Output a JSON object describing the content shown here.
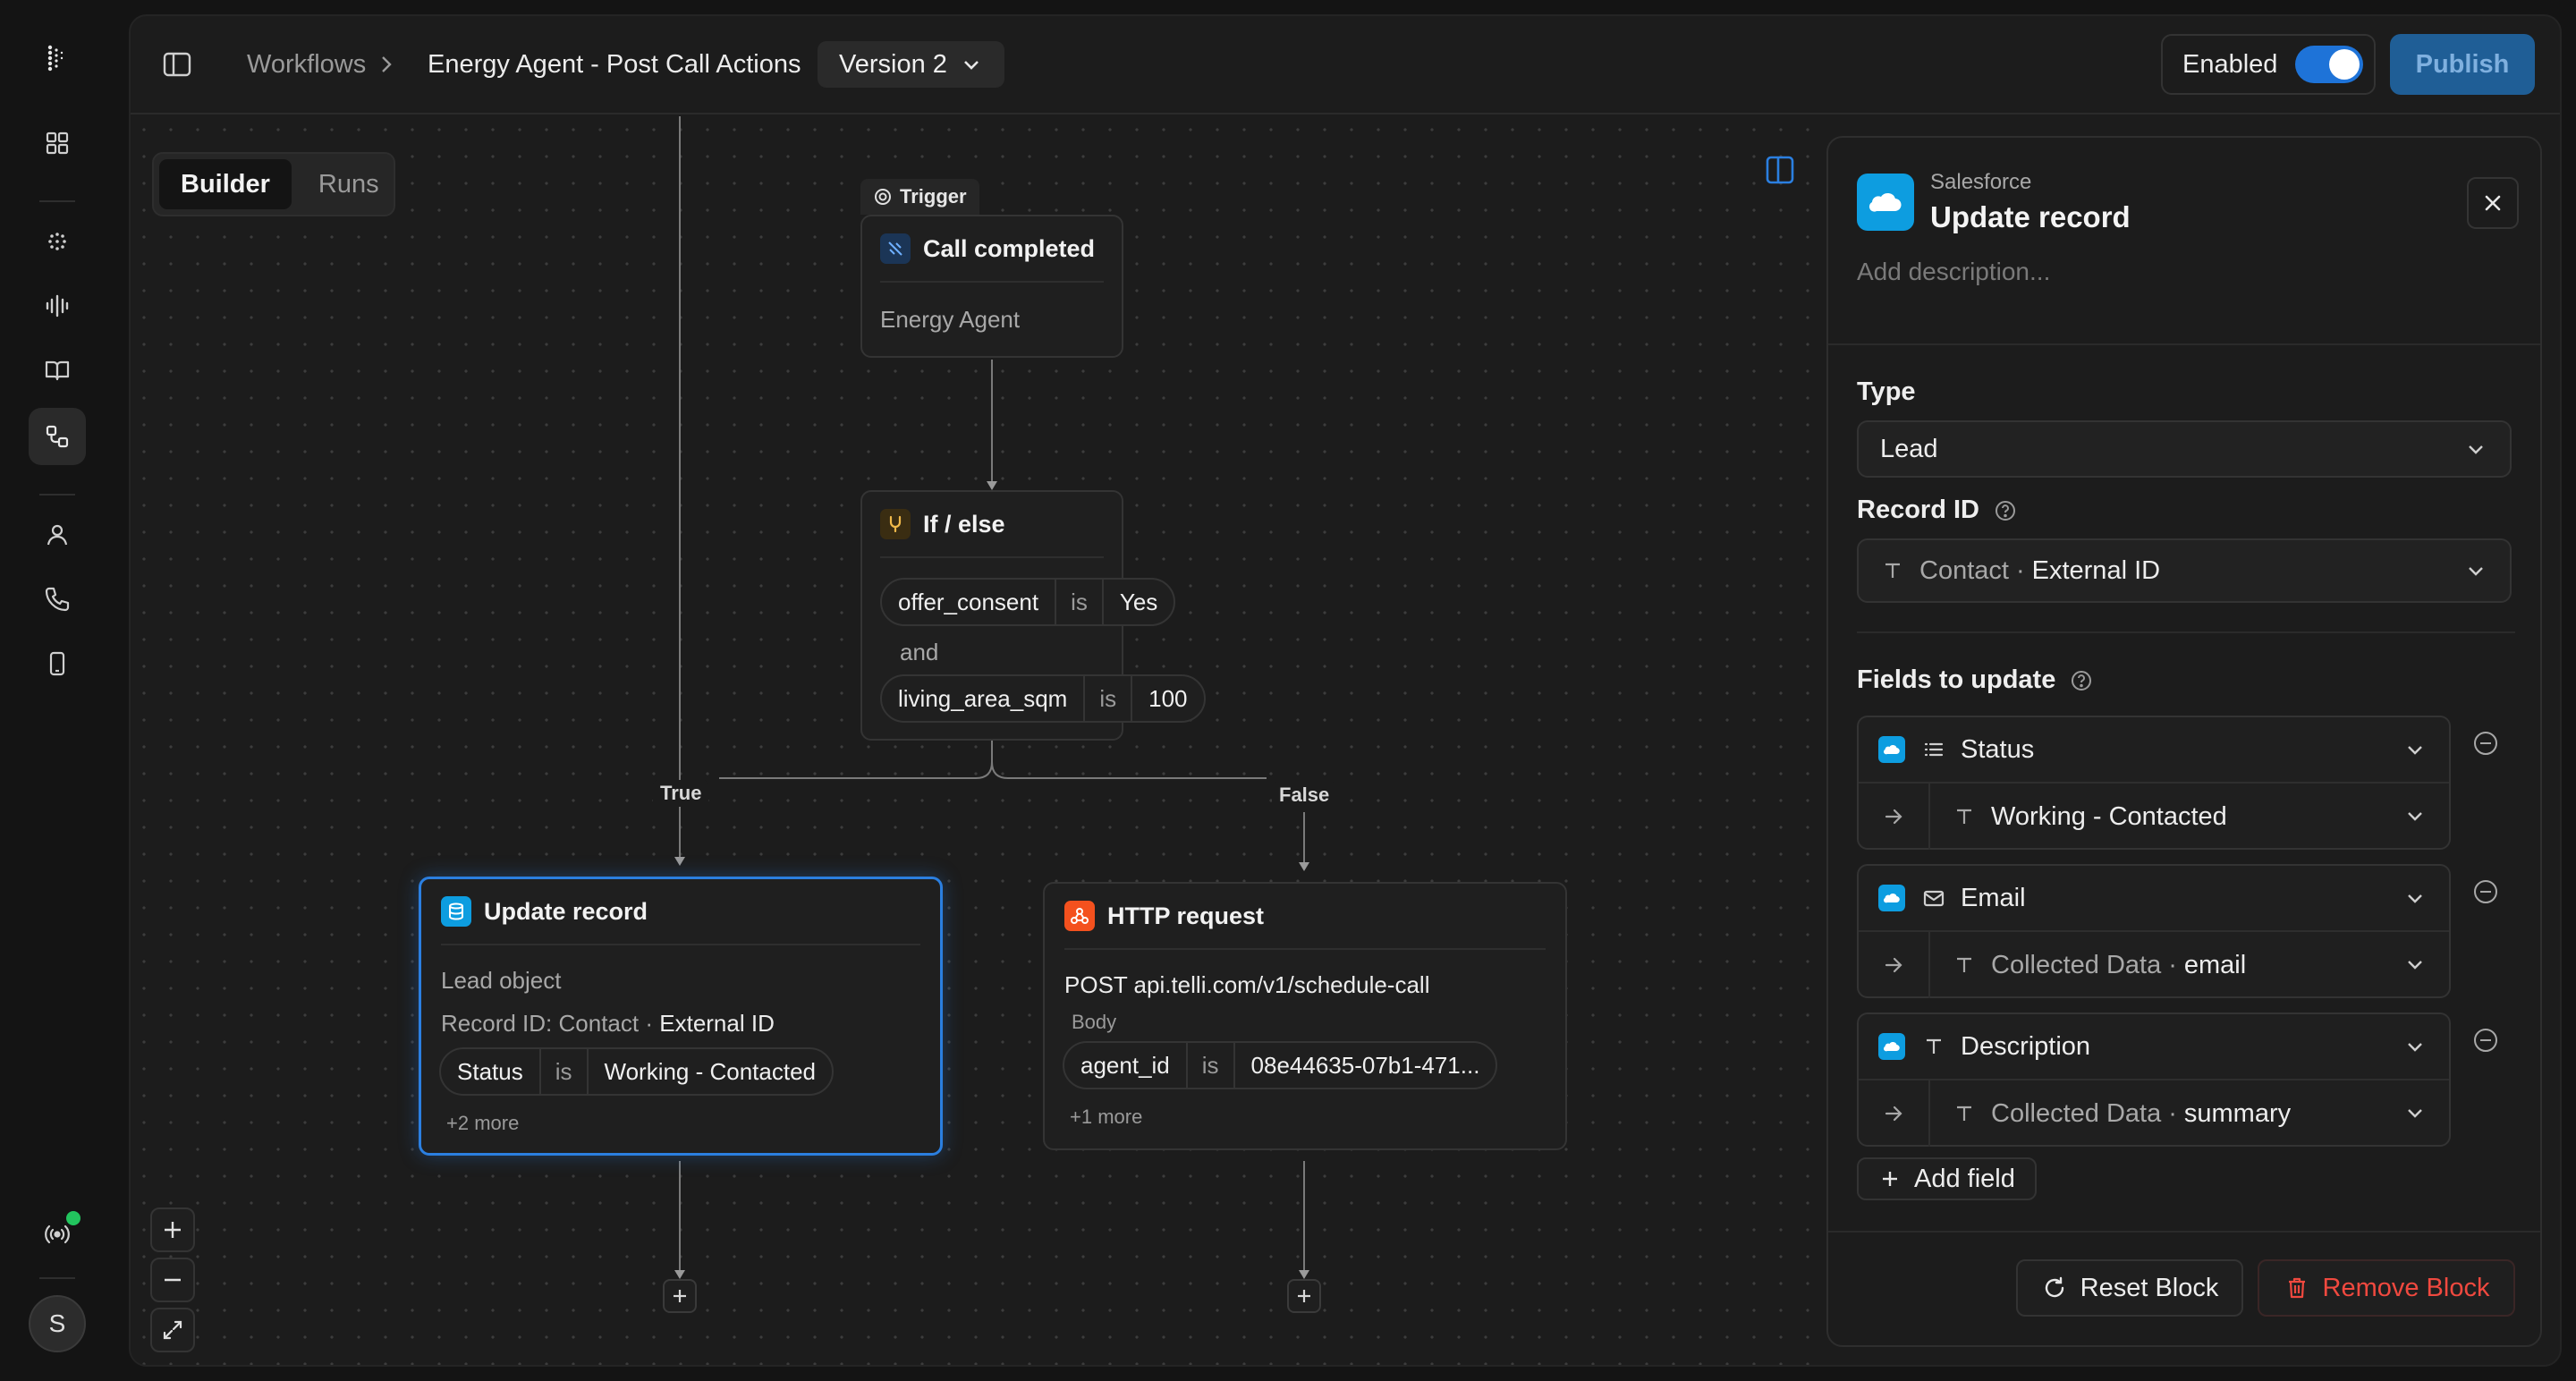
{
  "breadcrumb": {
    "root": "Workflows",
    "workflow": "Energy Agent - Post Call Actions",
    "version": "Version 2"
  },
  "header": {
    "enabled_label": "Enabled",
    "enabled": true,
    "publish_label": "Publish"
  },
  "canvas": {
    "tabs": [
      {
        "label": "Builder",
        "active": true
      },
      {
        "label": "Runs",
        "active": false
      }
    ],
    "trigger": {
      "tag": "Trigger",
      "title": "Call completed",
      "agent": "Energy Agent"
    },
    "ifelse": {
      "title": "If / else",
      "conditions": [
        {
          "field": "offer_consent",
          "op": "is",
          "value": "Yes"
        },
        {
          "field": "living_area_sqm",
          "op": "is",
          "value": "100"
        }
      ],
      "joiner": "and",
      "true_label": "True",
      "false_label": "False"
    },
    "update_node": {
      "title": "Update record",
      "object": "Lead object",
      "record_label": "Record ID:",
      "record_source": "Contact",
      "record_dot": "·",
      "record_field": "External ID",
      "condition": {
        "field": "Status",
        "op": "is",
        "value": "Working - Contacted"
      },
      "more": "+2 more"
    },
    "http_node": {
      "title": "HTTP request",
      "request": "POST api.telli.com/v1/schedule-call",
      "body_label": "Body",
      "param": {
        "field": "agent_id",
        "op": "is",
        "value": "08e44635-07b1-471..."
      },
      "more": "+1 more"
    }
  },
  "side_panel": {
    "provider": "Salesforce",
    "title": "Update record",
    "description_placeholder": "Add description...",
    "type_label": "Type",
    "type_value": "Lead",
    "record_id_label": "Record ID",
    "record_id_source": "Contact",
    "record_id_dot": "·",
    "record_id_field": "External ID",
    "fields_label": "Fields to update",
    "fields": [
      {
        "name": "Status",
        "icon": "list-icon",
        "source": "Working - Contacted",
        "source_field": ""
      },
      {
        "name": "Email",
        "icon": "mail-icon",
        "source": "Collected Data",
        "source_field": "email"
      },
      {
        "name": "Description",
        "icon": "text-type-icon",
        "source": "Collected Data",
        "source_field": "summary"
      }
    ],
    "add_field_label": "Add field",
    "reset_label": "Reset Block",
    "remove_label": "Remove Block"
  },
  "user": {
    "initial": "S"
  },
  "colors": {
    "accent": "#2b7fe0",
    "salesforce": "#0d9de0",
    "http": "#f4511e",
    "danger": "#f0493f",
    "status_live": "#22c55e"
  }
}
